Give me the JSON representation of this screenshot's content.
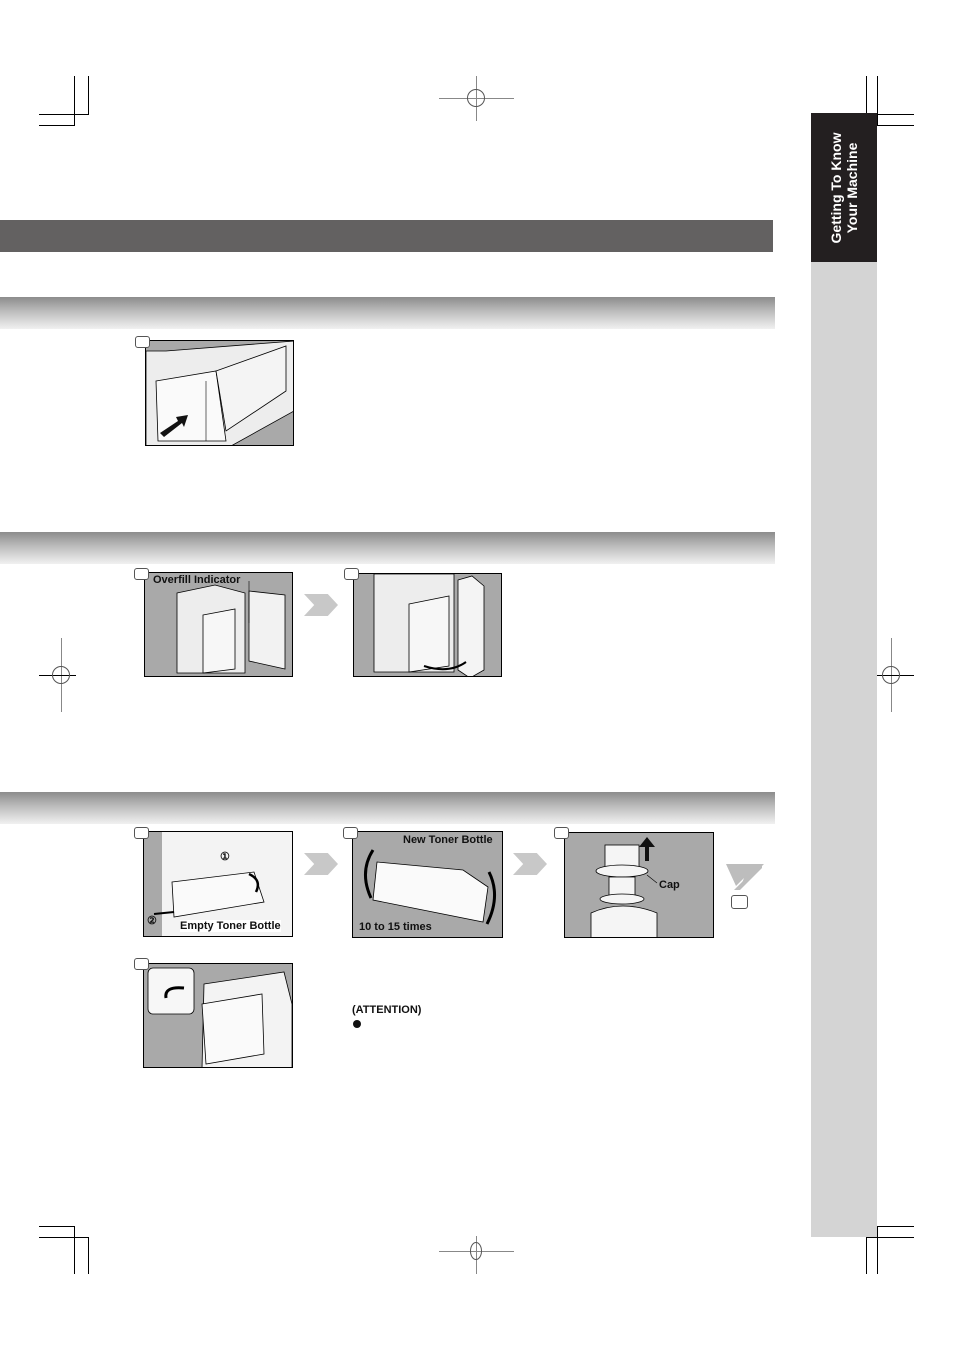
{
  "side_tab": {
    "line1": "Getting To Know",
    "line2": "Your Machine"
  },
  "sections": [
    {
      "id": "paper-tray",
      "figures": [
        {
          "step": "",
          "labels": []
        }
      ]
    },
    {
      "id": "overfill",
      "figures": [
        {
          "step": "",
          "labels": [
            "Overfill Indicator"
          ]
        },
        {
          "step": "",
          "labels": []
        }
      ]
    },
    {
      "id": "toner",
      "figures": [
        {
          "step": "",
          "labels": [
            "Empty Toner Bottle",
            "①",
            "②"
          ]
        },
        {
          "step": "",
          "labels": [
            "New Toner Bottle",
            "10 to 15 times"
          ]
        },
        {
          "step": "",
          "labels": [
            "Cap"
          ]
        },
        {
          "step": "",
          "labels": []
        }
      ]
    }
  ],
  "attention": {
    "heading": "(ATTENTION)"
  },
  "colors": {
    "title_bar": "#636161",
    "side_tab": "#231f20",
    "side_strip": "#d4d4d4",
    "figure_bg": "#a9a9a9"
  }
}
